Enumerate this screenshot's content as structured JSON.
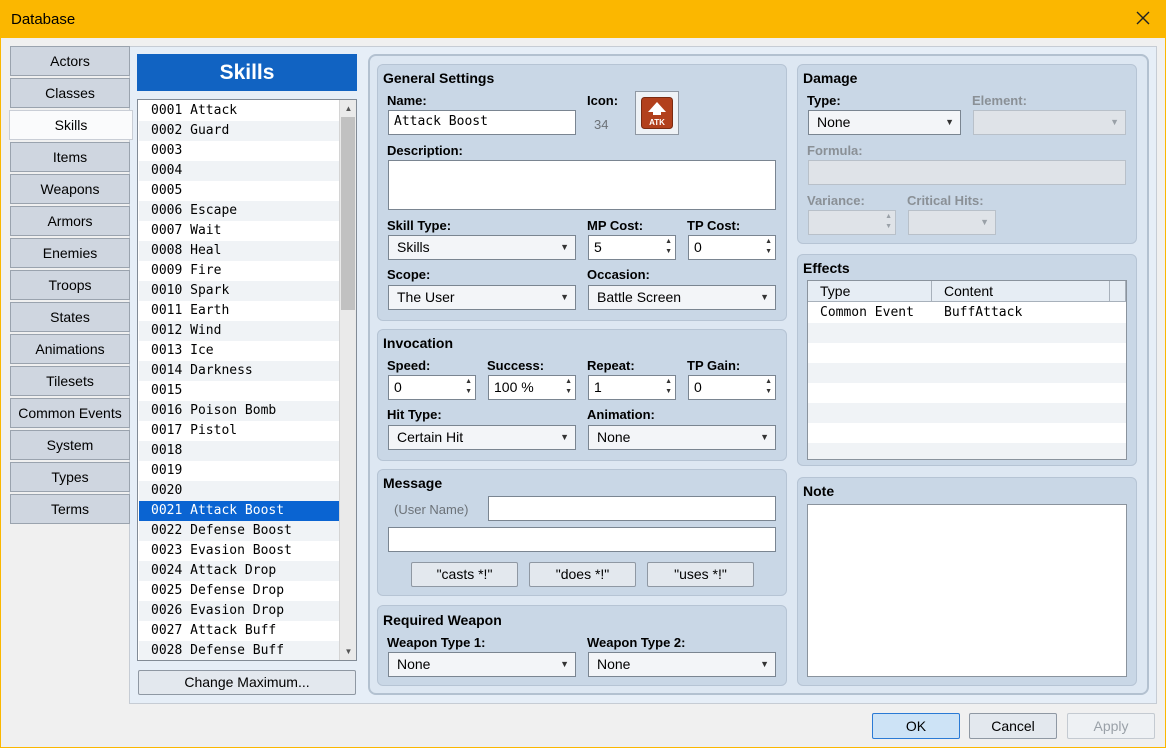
{
  "window": {
    "title": "Database"
  },
  "tabs": [
    "Actors",
    "Classes",
    "Skills",
    "Items",
    "Weapons",
    "Armors",
    "Enemies",
    "Troops",
    "States",
    "Animations",
    "Tilesets",
    "Common Events",
    "System",
    "Types",
    "Terms"
  ],
  "active_tab": "Skills",
  "list": {
    "header": "Skills",
    "items": [
      "0001 Attack",
      "0002 Guard",
      "0003",
      "0004",
      "0005",
      "0006 Escape",
      "0007 Wait",
      "0008 Heal",
      "0009 Fire",
      "0010 Spark",
      "0011 Earth",
      "0012 Wind",
      "0013 Ice",
      "0014 Darkness",
      "0015",
      "0016 Poison Bomb",
      "0017 Pistol",
      "0018",
      "0019",
      "0020",
      "0021 Attack Boost",
      "0022 Defense Boost",
      "0023 Evasion Boost",
      "0024 Attack Drop",
      "0025 Defense Drop",
      "0026 Evasion Drop",
      "0027 Attack Buff",
      "0028 Defense Buff"
    ],
    "selected": "0021 Attack Boost",
    "change_max": "Change Maximum..."
  },
  "general": {
    "title": "General Settings",
    "name_label": "Name:",
    "name_value": "Attack Boost",
    "icon_label": "Icon:",
    "icon_index": "34",
    "icon_text": "ATK",
    "desc_label": "Description:",
    "skill_type_label": "Skill Type:",
    "skill_type": "Skills",
    "mp_label": "MP Cost:",
    "mp_value": "5",
    "tp_label": "TP Cost:",
    "tp_value": "0",
    "scope_label": "Scope:",
    "scope": "The User",
    "occasion_label": "Occasion:",
    "occasion": "Battle Screen"
  },
  "invocation": {
    "title": "Invocation",
    "speed_label": "Speed:",
    "speed": "0",
    "success_label": "Success:",
    "success": "100 %",
    "repeat_label": "Repeat:",
    "repeat": "1",
    "tpgain_label": "TP Gain:",
    "tpgain": "0",
    "hit_label": "Hit Type:",
    "hit": "Certain Hit",
    "anim_label": "Animation:",
    "anim": "None"
  },
  "message": {
    "title": "Message",
    "user_name": "(User Name)",
    "btn_casts": "\"casts *!\"",
    "btn_does": "\"does *!\"",
    "btn_uses": "\"uses *!\""
  },
  "weapon": {
    "title": "Required Weapon",
    "w1_label": "Weapon Type 1:",
    "w1": "None",
    "w2_label": "Weapon Type 2:",
    "w2": "None"
  },
  "damage": {
    "title": "Damage",
    "type_label": "Type:",
    "type": "None",
    "element_label": "Element:",
    "formula_label": "Formula:",
    "variance_label": "Variance:",
    "crit_label": "Critical Hits:"
  },
  "effects": {
    "title": "Effects",
    "col_type": "Type",
    "col_content": "Content",
    "rows": [
      {
        "type": "Common Event",
        "content": "BuffAttack"
      }
    ]
  },
  "note": {
    "title": "Note"
  },
  "footer": {
    "ok": "OK",
    "cancel": "Cancel",
    "apply": "Apply"
  },
  "colors": {
    "titlebar": "#fbb700",
    "selection": "#0a64d2",
    "list_header": "#1163c2",
    "icon": "#b2401c"
  }
}
